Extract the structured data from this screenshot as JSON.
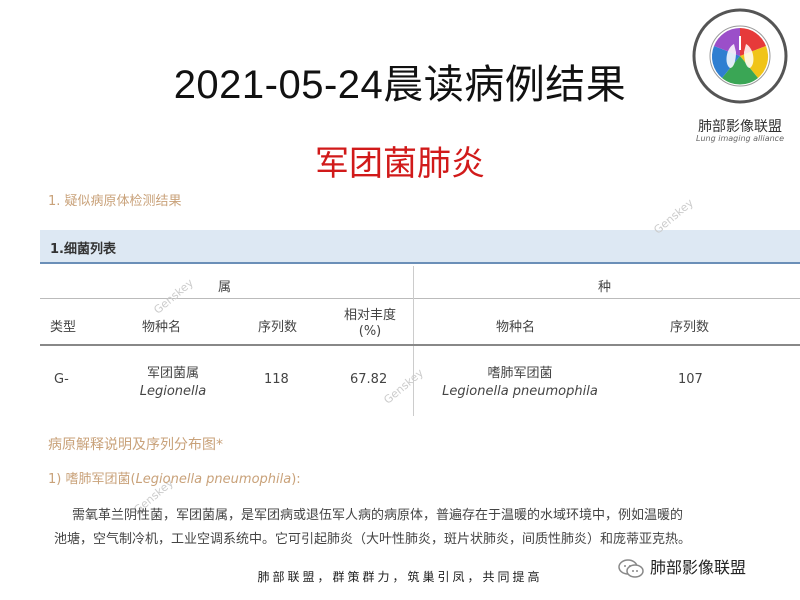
{
  "title": "2021-05-24晨读病例结果",
  "subtitle": "军团菌肺炎",
  "logo": {
    "ring_text": "肺部影像联盟",
    "ring_text_en": "LUNG IMAGING ALLIANCE",
    "label": "肺部影像联盟",
    "label_en": "Lung imaging alliance",
    "colors": [
      "#e63a3a",
      "#f0c419",
      "#3aa655",
      "#2f7fd1",
      "#9b4fc9"
    ]
  },
  "report": {
    "section1": "1. 疑似病原体检测结果",
    "table_title": "1.细菌列表",
    "group_headers": [
      "属",
      "种"
    ],
    "columns": {
      "type": "类型",
      "genus_name": "物种名",
      "genus_reads": "序列数",
      "abundance": "相对丰度 (%)",
      "species_name": "物种名",
      "species_reads": "序列数"
    },
    "row": {
      "type": "G-",
      "genus_cn": "军团菌属",
      "genus_latin": "Legionella",
      "genus_reads": "118",
      "abundance": "67.82",
      "species_cn": "嗜肺军团菌",
      "species_latin": "Legionella pneumophila",
      "species_reads": "107"
    },
    "section2": "病原解释说明及序列分布图*",
    "section3_prefix": "1) 嗜肺军团菌(",
    "section3_latin": "Legionella pneumophila",
    "section3_suffix": "):",
    "para_line1": "需氧革兰阴性菌，军团菌属，是军团病或退伍军人病的病原体，普遍存在于温暖的水域环境中，例如温暖的",
    "para_line2": "池塘，空气制冷机，工业空调系统中。它可引起肺炎（大叶性肺炎，斑片状肺炎，间质性肺炎）和庞蒂亚克热。",
    "watermark": "Genskey"
  },
  "footer": "肺部联盟，群策群力，筑巢引凤，共同提高",
  "wechat_label": "肺部影像联盟"
}
